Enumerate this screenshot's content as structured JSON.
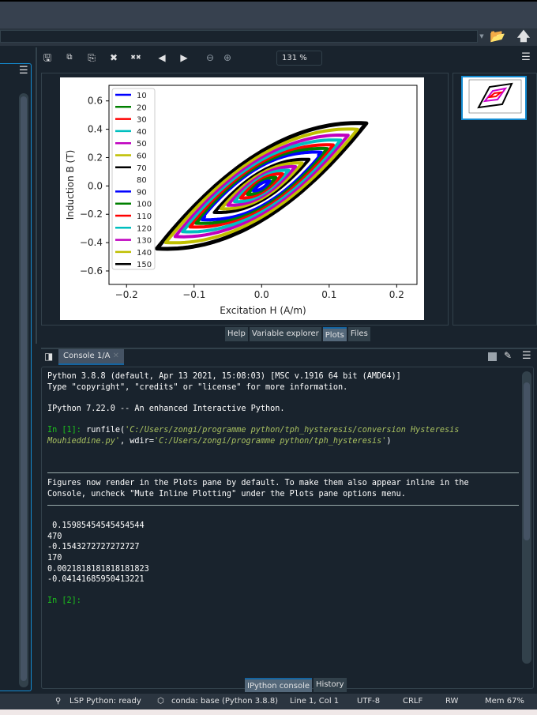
{
  "toolbar": {
    "zoom": "131 %"
  },
  "plot_tabs": [
    "Help",
    "Variable explorer",
    "Plots",
    "Files"
  ],
  "console": {
    "tab": "Console 1/A",
    "lines": {
      "l1": "Python 3.8.8 (default, Apr 13 2021, 15:08:03) [MSC v.1916 64 bit (AMD64)]",
      "l2": "Type \"copyright\", \"credits\" or \"license\" for more information.",
      "l3": "IPython 7.22.0 -- An enhanced Interactive Python.",
      "prompt1": "In [1]: ",
      "run_a": "runfile(",
      "run_b": "'C:/Users/zongi/programme python/tph_hysteresis/conversion Hysteresis",
      "run_c": "Mouhieddine.py'",
      "run_d": ", wdir=",
      "run_e": "'C:/Users/zongi/programme python/tph_hysteresis'",
      "run_f": ")",
      "info1": "Figures now render in the Plots pane by default. To make them also appear inline in the",
      "info2": "Console, uncheck \"Mute Inline Plotting\" under the Plots pane options menu.",
      "out1": " 0.15985454545454544",
      "out2": "470",
      "out3": "-0.1543272727272727",
      "out4": "170",
      "out5": "0.0021818181818181823",
      "out6": "-0.04141685950413221",
      "prompt2": "In [2]:"
    }
  },
  "console_tabs": [
    "IPython console",
    "History"
  ],
  "status": {
    "lsp": "LSP Python: ready",
    "conda": "conda: base (Python 3.8.8)",
    "pos": "Line 1, Col 1",
    "enc": "UTF-8",
    "eol": "CRLF",
    "rw": "RW",
    "mem": "Mem 67%"
  },
  "chart_data": {
    "type": "line",
    "xlabel": "Excitation H (A/m)",
    "ylabel": "Induction B (T)",
    "xlim": [
      -0.226,
      0.23
    ],
    "ylim": [
      -0.695,
      0.71
    ],
    "xticks": [
      "−0.2",
      "−0.1",
      "0.0",
      "0.1",
      "0.2"
    ],
    "xtick_values": [
      -0.2,
      -0.1,
      0,
      0.1,
      0.2
    ],
    "yticks": [
      "0.6",
      "0.4",
      "0.2",
      "0.0",
      "−0.2",
      "−0.4",
      "−0.6"
    ],
    "ytick_values": [
      0.6,
      0.4,
      0.2,
      0,
      -0.2,
      -0.4,
      -0.6
    ],
    "legend_position": "upper-left",
    "series": [
      {
        "name": "10",
        "color": "#0000ff",
        "h_max": 0.012,
        "b_max": 0.04
      },
      {
        "name": "20",
        "color": "#008000",
        "h_max": 0.021,
        "b_max": 0.07
      },
      {
        "name": "30",
        "color": "#ff0000",
        "h_max": 0.031,
        "b_max": 0.1
      },
      {
        "name": "40",
        "color": "#00bfbf",
        "h_max": 0.04,
        "b_max": 0.13
      },
      {
        "name": "50",
        "color": "#bf00bf",
        "h_max": 0.05,
        "b_max": 0.16
      },
      {
        "name": "60",
        "color": "#bfbf00",
        "h_max": 0.06,
        "b_max": 0.19
      },
      {
        "name": "70",
        "color": "#000000",
        "h_max": 0.07,
        "b_max": 0.22
      },
      {
        "name": "80",
        "color": "#ffffff",
        "h_max": 0.08,
        "b_max": 0.25
      },
      {
        "name": "90",
        "color": "#0000ff",
        "h_max": 0.088,
        "b_max": 0.28
      },
      {
        "name": "100",
        "color": "#008000",
        "h_max": 0.097,
        "b_max": 0.31
      },
      {
        "name": "110",
        "color": "#ff0000",
        "h_max": 0.106,
        "b_max": 0.34
      },
      {
        "name": "120",
        "color": "#00bfbf",
        "h_max": 0.117,
        "b_max": 0.38
      },
      {
        "name": "130",
        "color": "#bf00bf",
        "h_max": 0.128,
        "b_max": 0.42
      },
      {
        "name": "140",
        "color": "#bfbf00",
        "h_max": 0.142,
        "b_max": 0.47
      },
      {
        "name": "150",
        "color": "#000000",
        "h_max": 0.155,
        "b_max": 0.52
      }
    ]
  }
}
